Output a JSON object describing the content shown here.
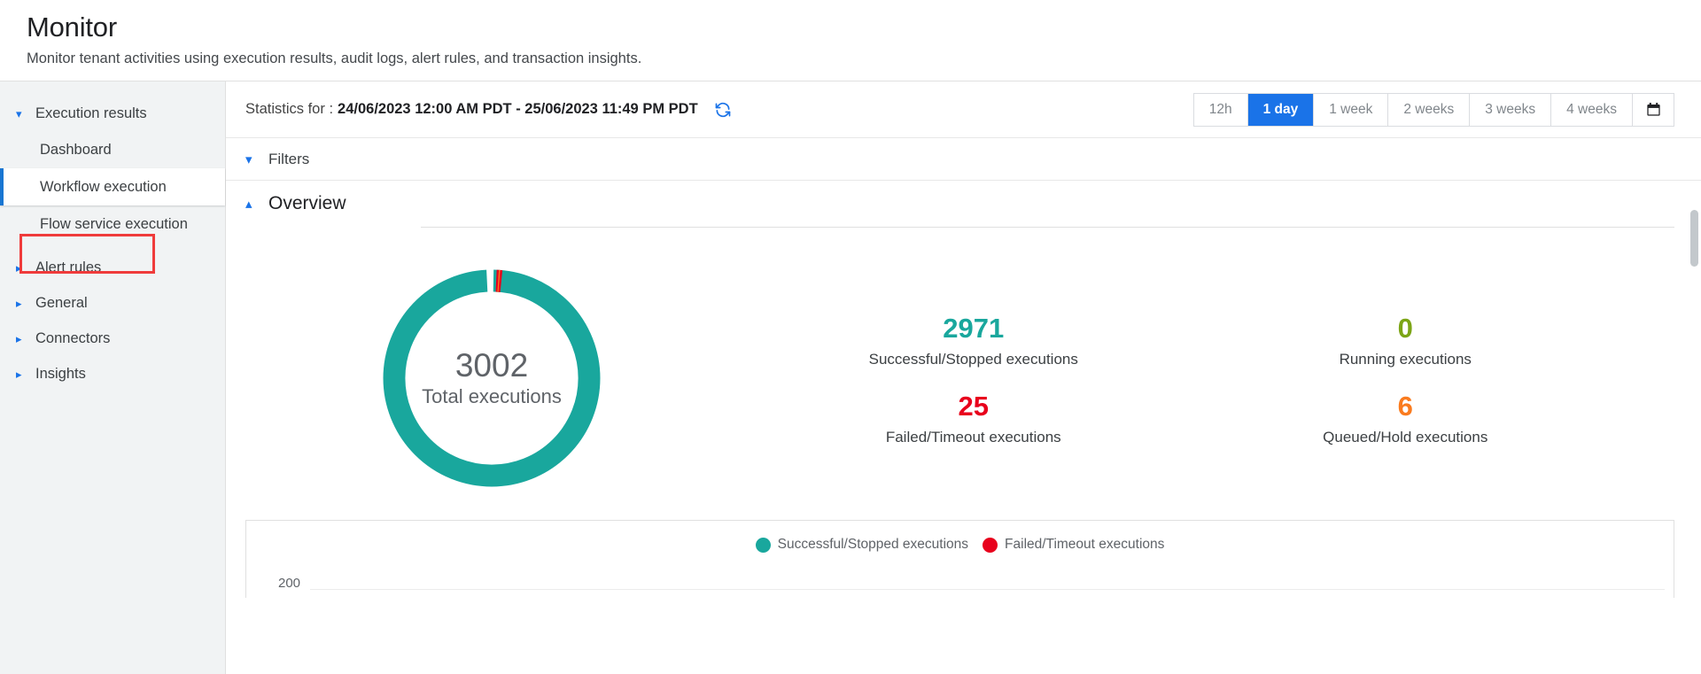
{
  "header": {
    "title": "Monitor",
    "subtitle": "Monitor tenant activities using execution results, audit logs, alert rules, and transaction insights."
  },
  "sidebar": {
    "groups": [
      {
        "label": "Execution results",
        "icon": "chevron-down-icon",
        "expanded": true,
        "items": [
          {
            "label": "Dashboard",
            "active": false
          },
          {
            "label": "Workflow execution",
            "active": true
          },
          {
            "label": "Flow service execution",
            "active": false
          }
        ]
      },
      {
        "label": "Alert rules",
        "icon": "chevron-right-icon",
        "expanded": false,
        "items": []
      },
      {
        "label": "General",
        "icon": "chevron-right-icon",
        "expanded": false,
        "items": []
      },
      {
        "label": "Connectors",
        "icon": "chevron-right-icon",
        "expanded": false,
        "items": []
      },
      {
        "label": "Insights",
        "icon": "chevron-right-icon",
        "expanded": false,
        "items": []
      }
    ]
  },
  "toolbar": {
    "stats_label": "Statistics for :",
    "date_range": "24/06/2023 12:00 AM PDT - 25/06/2023 11:49 PM PDT",
    "refresh_icon": "refresh-icon",
    "calendar_icon": "calendar-icon",
    "range_buttons": [
      {
        "label": "12h",
        "selected": false
      },
      {
        "label": "1 day",
        "selected": true
      },
      {
        "label": "1 week",
        "selected": false
      },
      {
        "label": "2 weeks",
        "selected": false
      },
      {
        "label": "3 weeks",
        "selected": false
      },
      {
        "label": "4 weeks",
        "selected": false
      }
    ]
  },
  "sections": {
    "filters": {
      "title": "Filters",
      "icon": "chevron-down-icon",
      "expanded": false
    },
    "overview": {
      "title": "Overview",
      "icon": "chevron-up-icon",
      "expanded": true
    }
  },
  "overview": {
    "donut": {
      "total_value": "3002",
      "total_label": "Total executions"
    },
    "stats": [
      {
        "value": "2971",
        "caption": "Successful/Stopped executions",
        "color": "#19A79D"
      },
      {
        "value": "0",
        "caption": "Running executions",
        "color": "#7CA516"
      },
      {
        "value": "25",
        "caption": "Failed/Timeout executions",
        "color": "#E8001C"
      },
      {
        "value": "6",
        "caption": "Queued/Hold executions",
        "color": "#FA7B1E"
      }
    ]
  },
  "chart_data": {
    "type": "pie",
    "title": "Total executions",
    "categories": [
      "Successful/Stopped executions",
      "Failed/Timeout executions",
      "Queued/Hold executions",
      "Running executions"
    ],
    "values": [
      2971,
      25,
      6,
      0
    ],
    "total": 3002,
    "colors": [
      "#19A79D",
      "#E8001C",
      "#FA7B1E",
      "#7CA516"
    ],
    "legend": [
      "Successful/Stopped executions",
      "Failed/Timeout executions"
    ],
    "legend_position": "bottom",
    "donut": true
  },
  "bottom_chart": {
    "legend": [
      {
        "label": "Successful/Stopped executions",
        "color": "#19A79D"
      },
      {
        "label": "Failed/Timeout executions",
        "color": "#E8001C"
      }
    ],
    "y_tick": "200"
  },
  "colors": {
    "accent_blue": "#1a73e8",
    "active_indicator": "#1976d2",
    "teal": "#19A79D",
    "red": "#E8001C",
    "orange": "#FA7B1E",
    "olive": "#7CA516",
    "annotation_red": "#EF3B3B"
  }
}
